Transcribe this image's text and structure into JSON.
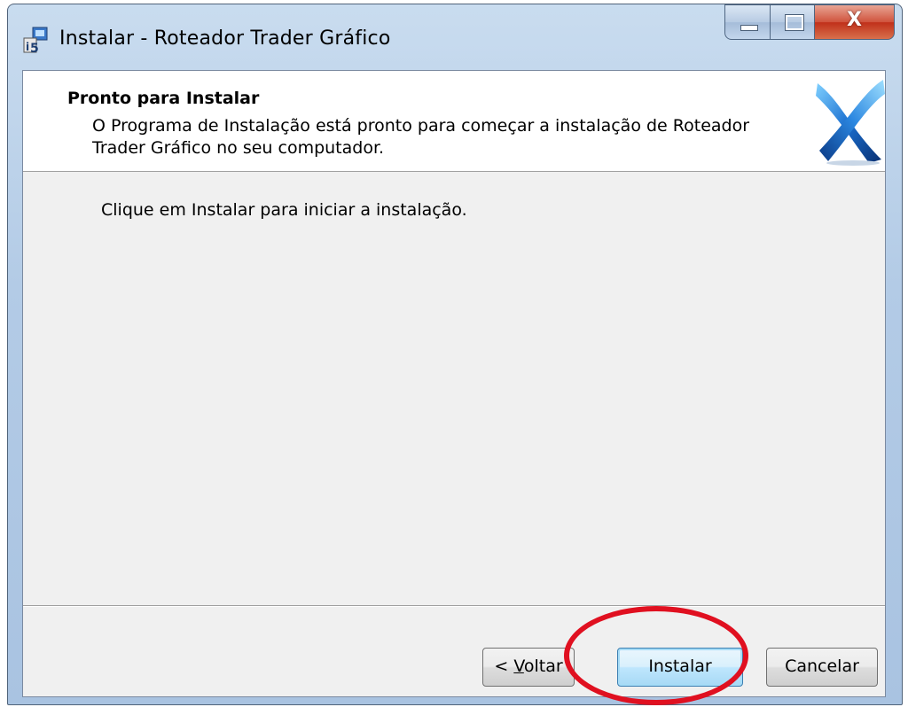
{
  "window": {
    "title": "Instalar - Roteador Trader Gráfico",
    "icon": "installer-icon"
  },
  "caption_buttons": {
    "minimize_icon": "minimize-icon",
    "maximize_icon": "maximize-icon",
    "close_label": "X"
  },
  "header": {
    "title": "Pronto para Instalar",
    "description": "O Programa de Instalação está pronto para começar a instalação de Roteador Trader Gráfico no seu computador.",
    "logo": "app-logo"
  },
  "body": {
    "text": "Clique em Instalar para iniciar a instalação."
  },
  "buttons": {
    "back_prefix": "< ",
    "back_accel": "V",
    "back_rest": "oltar",
    "install": "Instalar",
    "cancel": "Cancelar"
  },
  "colors": {
    "annotation": "#e01020",
    "accent_button_border": "#3c7fb1"
  }
}
